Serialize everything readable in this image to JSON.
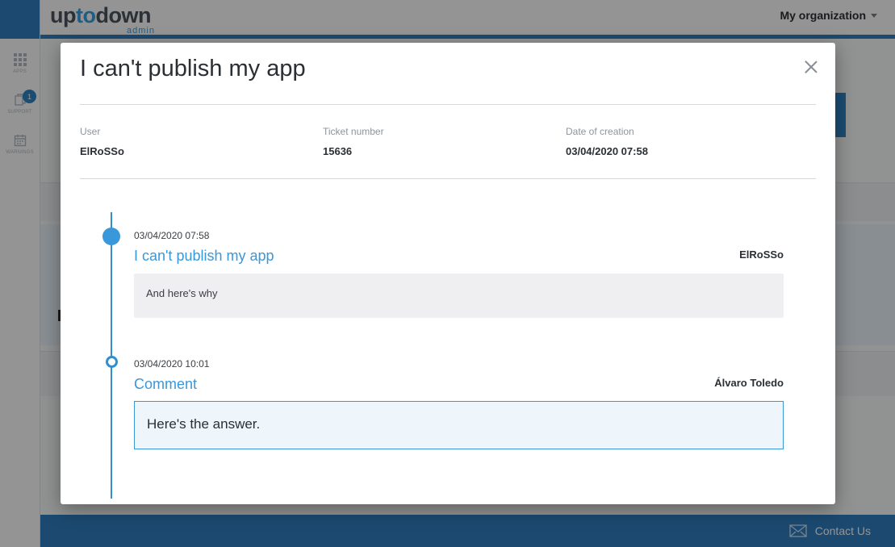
{
  "topbar": {
    "logo_main_a": "up",
    "logo_main_b": "to",
    "logo_main_c": "down",
    "logo_sub": "admin",
    "organization": "My organization"
  },
  "sidebar": {
    "items": [
      {
        "label": "APPS",
        "icon": "grid-icon"
      },
      {
        "label": "SUPPORT",
        "icon": "support-icon",
        "badge": "1"
      },
      {
        "label": "WARNINGS",
        "icon": "calendar-icon"
      }
    ]
  },
  "footer": {
    "contact_label": "Contact Us",
    "icon": "envelope-icon"
  },
  "modal": {
    "title": "I can't publish my app",
    "meta": [
      {
        "label": "User",
        "value": "ElRoSSo"
      },
      {
        "label": "Ticket number",
        "value": "15636"
      },
      {
        "label": "Date of creation",
        "value": "03/04/2020 07:58"
      }
    ],
    "entries": [
      {
        "date": "03/04/2020 07:58",
        "title": "I can't publish my app",
        "author": "ElRoSSo",
        "message": "And here's why"
      },
      {
        "date": "03/04/2020 10:01",
        "title": "Comment",
        "author": "Álvaro Toledo",
        "message": "Here's the answer."
      }
    ]
  },
  "colors": {
    "brand_blue": "#2f7fc1",
    "accent_blue": "#3a97da",
    "overlay": "rgba(0,0,0,0.42)"
  }
}
